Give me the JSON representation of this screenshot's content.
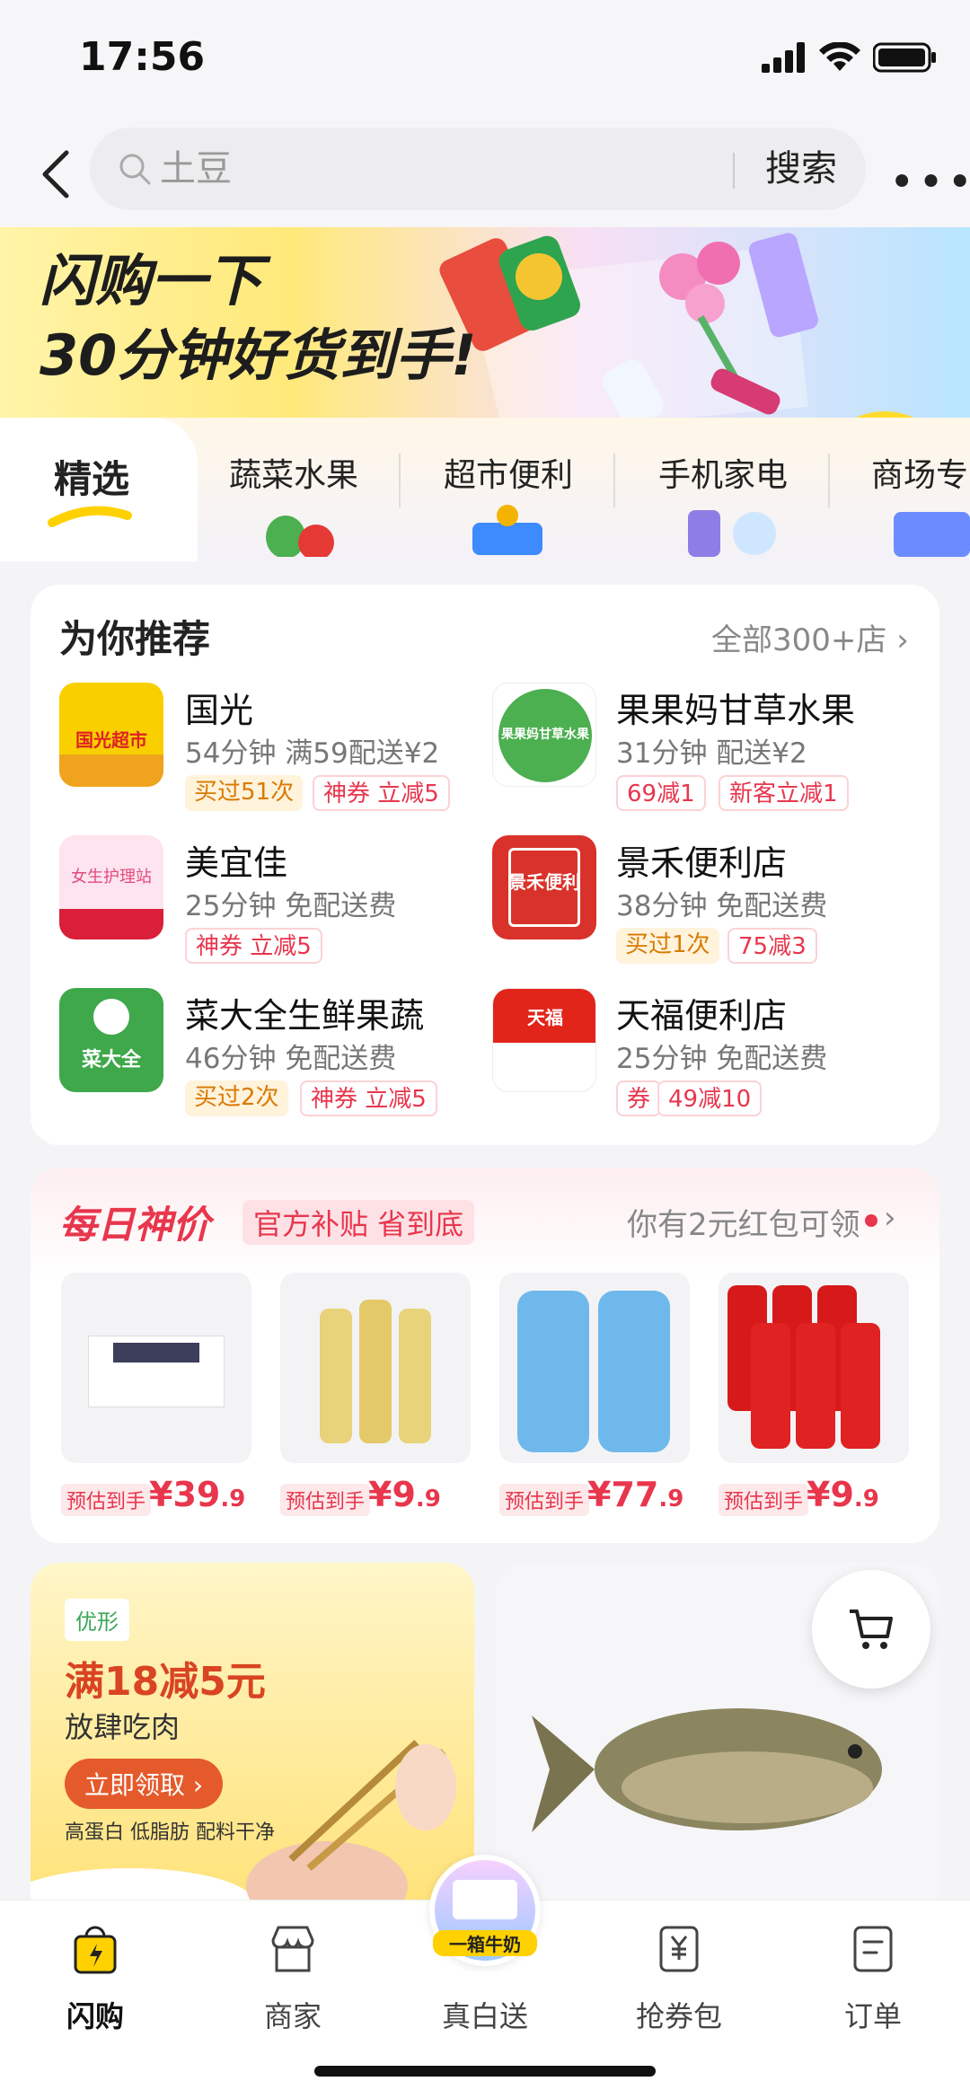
{
  "status": {
    "time": "17:56"
  },
  "search": {
    "placeholder": "土豆",
    "button": "搜索"
  },
  "banner": {
    "line1": "闪购一下",
    "line2": "30分钟好货到手!"
  },
  "categories": [
    "精选",
    "蔬菜水果",
    "超市便利",
    "手机家电",
    "商场专"
  ],
  "recommend": {
    "title": "为你推荐",
    "more": "全部300+店 ›",
    "shops": [
      {
        "name": "国光",
        "meta": "54分钟  满59配送¥2",
        "tags": [
          "买过51次",
          "神券 立减5"
        ],
        "logo_text": "国光超市"
      },
      {
        "name": "果果妈甘草水果",
        "meta": "31分钟  配送¥2",
        "tags": [
          "69减1",
          "新客立减1"
        ],
        "logo_text": "果果妈甘草水果"
      },
      {
        "name": "美宜佳",
        "meta": "25分钟  免配送费",
        "tags": [
          "神券 立减5"
        ],
        "logo_text": "女生护理站"
      },
      {
        "name": "景禾便利店",
        "meta": "38分钟  免配送费",
        "tags": [
          "买过1次",
          "75减3"
        ],
        "logo_text": "景禾便利"
      },
      {
        "name": "菜大全生鲜果蔬",
        "meta": "46分钟  免配送费",
        "tags": [
          "买过2次",
          "神券 立减5"
        ],
        "logo_text": "菜大全"
      },
      {
        "name": "天福便利店",
        "meta": "25分钟  免配送费",
        "tags": [
          "券",
          "49减10"
        ],
        "logo_text": "天福"
      }
    ]
  },
  "daily": {
    "title": "每日神价",
    "subtitle": "官方补贴 省到底",
    "more": "你有2元红包可领",
    "products": [
      {
        "label": "预估到手",
        "price": "¥39",
        "cents": ".9"
      },
      {
        "label": "预估到手",
        "price": "¥9",
        "cents": ".9"
      },
      {
        "label": "预估到手",
        "price": "¥77",
        "cents": ".9"
      },
      {
        "label": "预估到手",
        "price": "¥9",
        "cents": ".9"
      }
    ]
  },
  "promo": {
    "brand": "优形",
    "headline": "满18减5元",
    "sub": "放肆吃肉",
    "button": "立即领取 ›",
    "features": "高蛋白  低脂肪  配料干净"
  },
  "nav": [
    {
      "label": "闪购",
      "icon": "flash-bag-icon"
    },
    {
      "label": "商家",
      "icon": "store-icon"
    },
    {
      "label": "真白送",
      "icon": "gift-milk-icon",
      "badge": "一箱牛奶"
    },
    {
      "label": "抢券包",
      "icon": "coupon-icon"
    },
    {
      "label": "订单",
      "icon": "order-icon"
    }
  ],
  "colors": {
    "accent": "#e8364d",
    "brand_yellow": "#ffd100"
  }
}
